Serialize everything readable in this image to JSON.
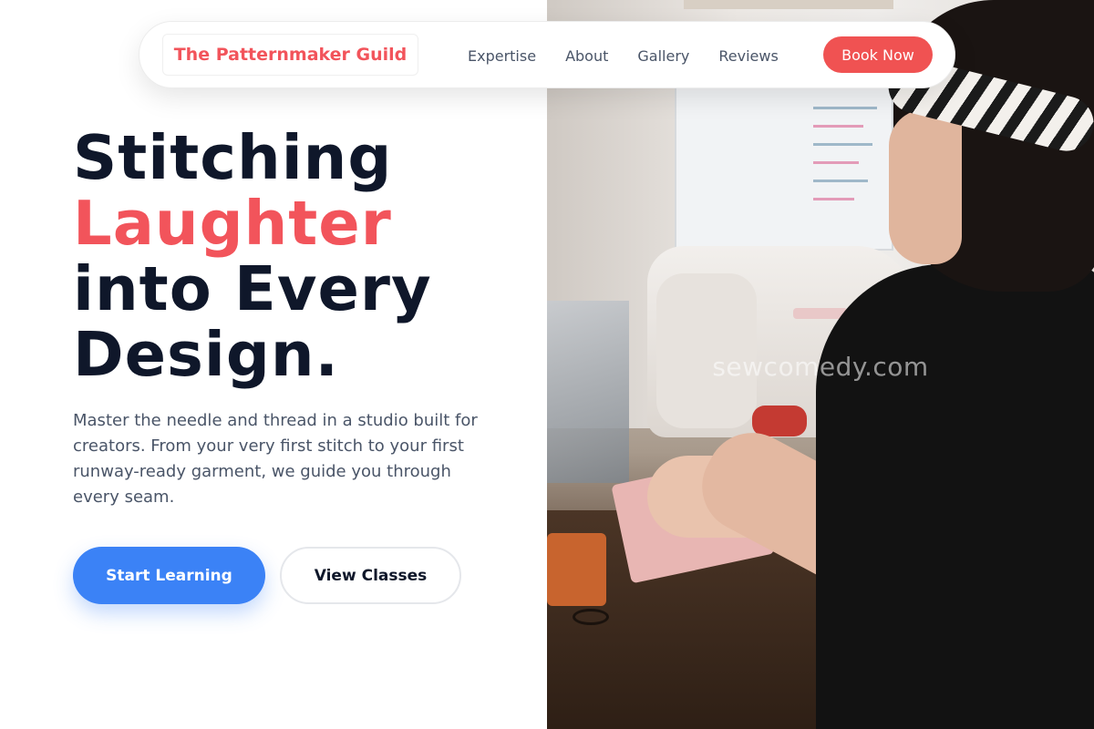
{
  "brand": {
    "name": "The Patternmaker Guild",
    "color": "#f2545b"
  },
  "nav": {
    "links": [
      "Expertise",
      "About",
      "Gallery",
      "Reviews"
    ],
    "cta": "Book Now"
  },
  "hero": {
    "title_line1": "Stitching",
    "title_line2": "Laughter",
    "title_line3": "into Every",
    "title_line4": "Design.",
    "description": "Master the needle and thread in a studio built for creators. From your very first stitch to your first runway-ready garment, we guide you through every seam.",
    "primary_button": "Start Learning",
    "secondary_button": "View Classes"
  },
  "photo": {
    "watermark": "sewcomedy.com"
  },
  "colors": {
    "accent": "#f2545b",
    "primary": "#3b82f6",
    "heading": "#0f172a",
    "body_text": "#4a5568"
  }
}
